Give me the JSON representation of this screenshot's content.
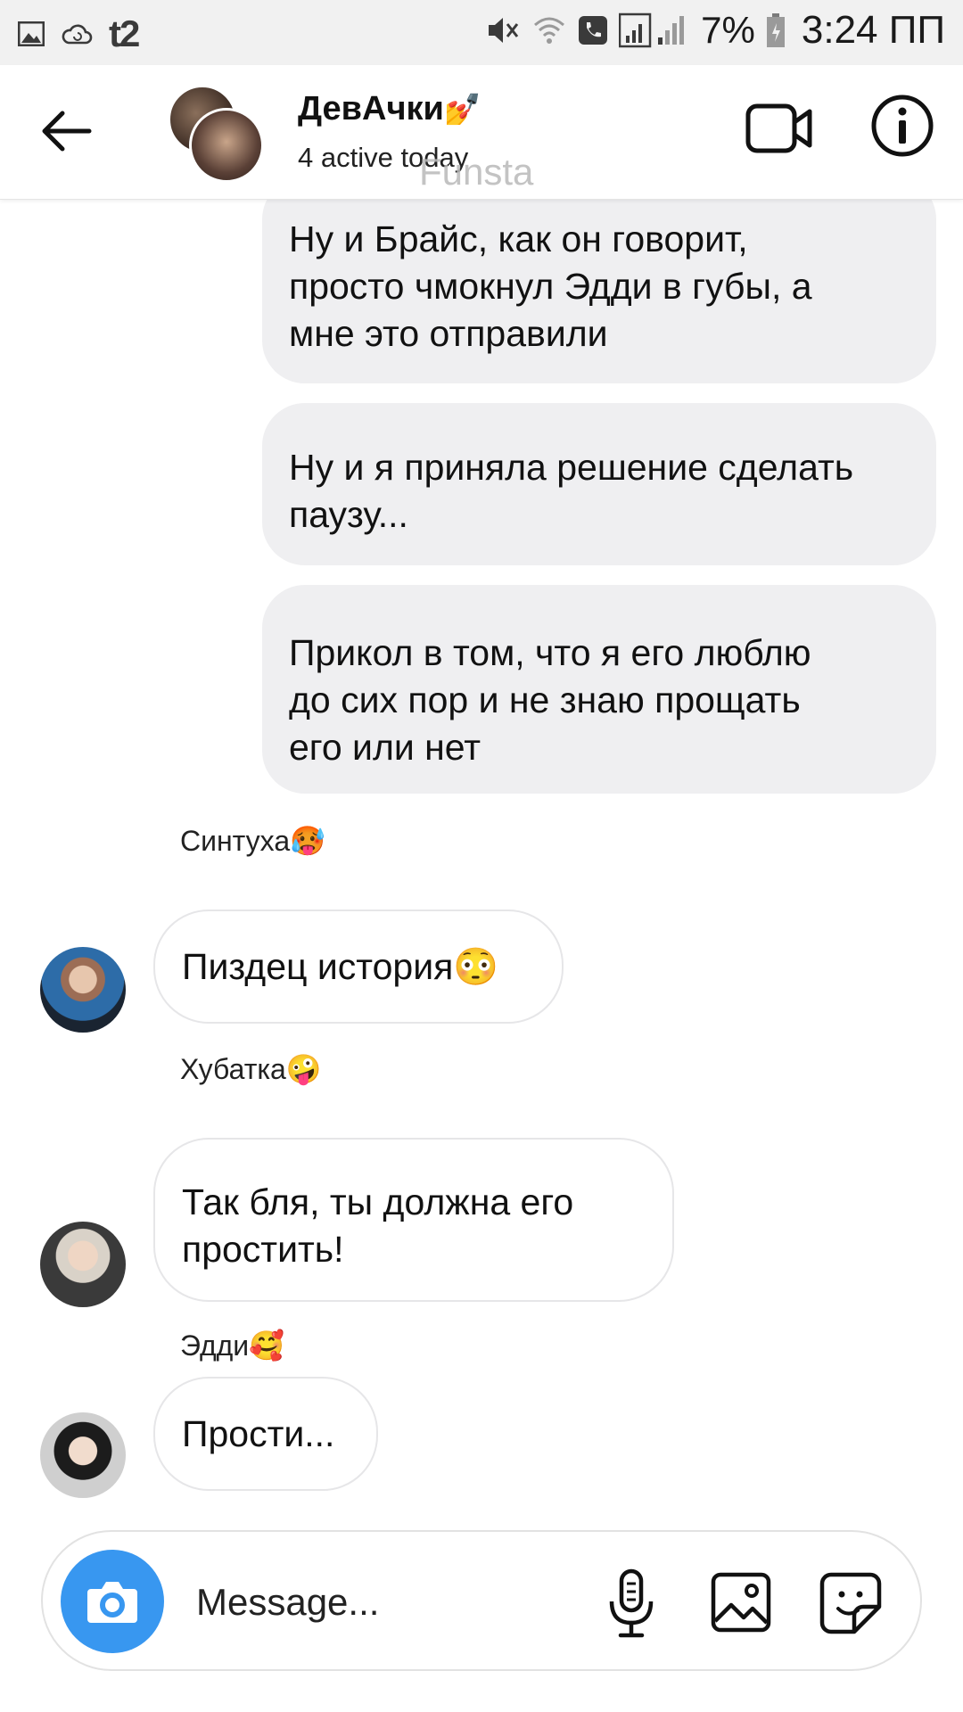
{
  "status_bar": {
    "carrier": "t2",
    "battery": "7%",
    "time": "3:24 ПП",
    "icons": [
      "gallery-icon",
      "cloud-sync-icon",
      "mute-icon",
      "wifi-icon",
      "phone-icon",
      "signal-icon",
      "battery-icon"
    ]
  },
  "header": {
    "title": "ДевАчки",
    "title_emoji": "💅",
    "subtitle": "4 active today",
    "watermark": "Funsta",
    "icons": [
      "back-arrow-icon",
      "video-call-icon",
      "info-icon"
    ]
  },
  "messages": [
    {
      "direction": "outgoing",
      "lines": [
        "Ну и Брайс, как он говорит,",
        "просто чмокнул Эдди в губы, а",
        "мне это отправили"
      ]
    },
    {
      "direction": "outgoing",
      "lines": [
        "Ну и я приняла решение сделать",
        "паузу..."
      ]
    },
    {
      "direction": "outgoing",
      "lines": [
        "Прикол в том, что я его люблю",
        "до сих пор и не знаю прощать",
        "его или нет"
      ]
    },
    {
      "direction": "incoming",
      "sender": "Синтуха🥵",
      "lines": [
        "Пиздец история😳"
      ]
    },
    {
      "direction": "incoming",
      "sender": "Хубатка🤪",
      "lines": [
        "Так бля, ты должна его",
        "простить!"
      ]
    },
    {
      "direction": "incoming",
      "sender": "Эдди🥰",
      "lines": [
        "Прости..."
      ]
    }
  ],
  "composer": {
    "placeholder": "Message...",
    "icons": [
      "camera-icon",
      "microphone-icon",
      "gallery-icon",
      "sticker-icon"
    ]
  },
  "colors": {
    "outgoing_bubble": "#efeff1",
    "incoming_border": "#e6e6e8",
    "camera_button": "#3897f0",
    "status_bar_bg": "#f1f1f1"
  }
}
